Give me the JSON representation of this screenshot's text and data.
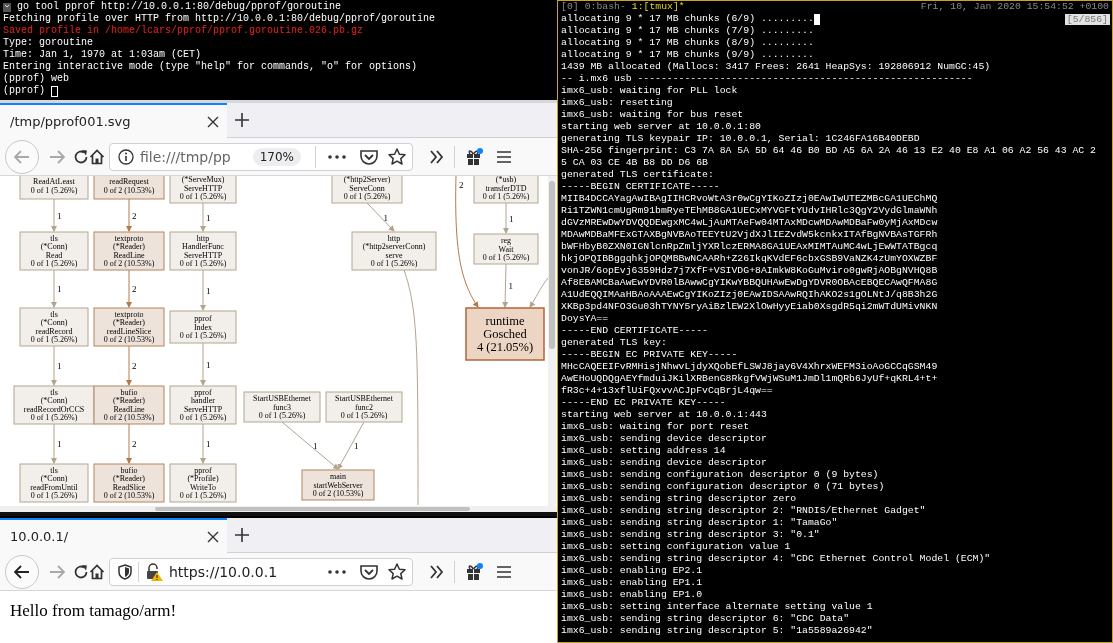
{
  "terminal": {
    "lines": [
      {
        "text": "go tool pprof http://10.0.0.1:80/debug/pprof/goroutine",
        "kind": "command",
        "cursor": false
      },
      {
        "text": "Fetching profile over HTTP from http://10.0.0.1:80/debug/pprof/goroutine",
        "kind": "output",
        "cursor": false
      },
      {
        "text": "Saved profile in /home/lcars/pprof/pprof.goroutine.026.pb.gz",
        "kind": "error",
        "cursor": false
      },
      {
        "text": "Type: goroutine",
        "kind": "output",
        "cursor": false
      },
      {
        "text": "Time: Jan 1, 1970 at 1:03am (CET)",
        "kind": "output",
        "cursor": false
      },
      {
        "text": "Entering interactive mode (type \"help\" for commands, \"o\" for options)",
        "kind": "output",
        "cursor": false
      },
      {
        "text": "(pprof) web",
        "kind": "output",
        "cursor": false
      },
      {
        "text": "(pprof)",
        "kind": "output",
        "cursor": true
      }
    ]
  },
  "browsers": [
    {
      "tabs": [
        {
          "title": "/tmp/pprof001.svg",
          "selected": true
        }
      ],
      "back_disabled": true,
      "forward_disabled": true,
      "gift_badge": true,
      "address": {
        "kind": "file",
        "url": "file:///tmp/pp",
        "zoom": "170%"
      },
      "content": {
        "kind": "graph",
        "graph": {
          "nodes": [
            {
              "lines": [
                "ReadAtLeast",
                "0 of 1 (5.26%)"
              ],
              "kind": "cold"
            },
            {
              "lines": [
                "tls",
                "(*Conn)",
                "Read",
                "0 of 1 (5.26%)"
              ],
              "kind": "cold"
            },
            {
              "lines": [
                "tls",
                "(*Conn)",
                "readRecord",
                "0 of 1 (5.26%)"
              ],
              "kind": "cold"
            },
            {
              "lines": [
                "tls",
                "(*Conn)",
                "readRecordOrCCS",
                "0 of 1 (5.26%)"
              ],
              "kind": "cold"
            },
            {
              "lines": [
                "tls",
                "(*Conn)",
                "readFromUntil",
                "0 of 1 (5.26%)"
              ],
              "kind": "cold"
            },
            {
              "lines": [
                "readRequest",
                "0 of 2 (10.53%)"
              ],
              "kind": "warm"
            },
            {
              "lines": [
                "textproto",
                "(*Reader)",
                "ReadLine",
                "0 of 2 (10.53%)"
              ],
              "kind": "warm"
            },
            {
              "lines": [
                "textproto",
                "(*Reader)",
                "readLineSlice",
                "0 of 2 (10.53%)"
              ],
              "kind": "warm"
            },
            {
              "lines": [
                "bufio",
                "(*Reader)",
                "ReadLine",
                "0 of 2 (10.53%)"
              ],
              "kind": "warm"
            },
            {
              "lines": [
                "bufio",
                "(*Reader)",
                "ReadSlice",
                "0 of 2 (10.53%)"
              ],
              "kind": "warm"
            },
            {
              "lines": [
                "(*ServeMux)",
                "ServeHTTP",
                "0 of 1 (5.26%)"
              ],
              "kind": "cold"
            },
            {
              "lines": [
                "http",
                "HandlerFunc",
                "ServeHTTP",
                "0 of 1 (5.26%)"
              ],
              "kind": "cold"
            },
            {
              "lines": [
                "pprof",
                "Index",
                "0 of 1 (5.26%)"
              ],
              "kind": "cold"
            },
            {
              "lines": [
                "pprof",
                "handler",
                "ServeHTTP",
                "0 of 1 (5.26%)"
              ],
              "kind": "cold"
            },
            {
              "lines": [
                "pprof",
                "(*Profile)",
                "WriteTo",
                "0 of 1 (5.26%)"
              ],
              "kind": "cold"
            },
            {
              "lines": [
                "(*http2Server)",
                "ServeConn",
                "0 of 1 (5.26%)"
              ],
              "kind": "cold"
            },
            {
              "lines": [
                "http",
                "(*http2serverConn)",
                "serve",
                "0 of 1 (5.26%)"
              ],
              "kind": "cold"
            },
            {
              "lines": [
                "StartUSBEthernet",
                "func3",
                "0 of 1 (5.26%)"
              ],
              "kind": "cold"
            },
            {
              "lines": [
                "StartUSBEthernet",
                "func2",
                "0 of 1 (5.26%)"
              ],
              "kind": "cold"
            },
            {
              "lines": [
                "main",
                "startWebServer",
                "0 of 2 (10.53%)"
              ],
              "kind": "warm"
            },
            {
              "lines": [
                "(*usb)",
                "transferDTD",
                "0 of 1 (5.26%)"
              ],
              "kind": "cold"
            },
            {
              "lines": [
                "reg",
                "Wait",
                "0 of 1 (5.26%)"
              ],
              "kind": "cold"
            },
            {
              "lines": [
                "runtime",
                "Gosched",
                "4 (21.05%)"
              ],
              "kind": "hot"
            }
          ],
          "edges": [
            {
              "label": "1",
              "kind": "cold"
            },
            {
              "label": "1",
              "kind": "cold"
            },
            {
              "label": "1",
              "kind": "cold"
            },
            {
              "label": "1",
              "kind": "cold"
            },
            {
              "label": "2",
              "kind": "warm"
            },
            {
              "label": "2",
              "kind": "warm"
            },
            {
              "label": "2",
              "kind": "warm"
            },
            {
              "label": "2",
              "kind": "warm"
            },
            {
              "label": "1",
              "kind": "cold"
            },
            {
              "label": "1",
              "kind": "cold"
            },
            {
              "label": "1",
              "kind": "cold"
            },
            {
              "label": "1",
              "kind": "cold"
            },
            {
              "label": "1",
              "kind": "cold"
            },
            {
              "label": "1",
              "kind": "cold"
            },
            {
              "label": "1",
              "kind": "cold"
            },
            {
              "label": "1",
              "kind": "cold"
            },
            {
              "label": "1",
              "kind": "cold"
            },
            {
              "label": "2",
              "kind": "warm"
            },
            {
              "kind": "cold"
            },
            {
              "kind": "cold"
            }
          ]
        }
      }
    },
    {
      "tabs": [
        {
          "title": "10.0.0.1/",
          "selected": true
        }
      ],
      "back_disabled": false,
      "forward_disabled": true,
      "gift_badge": true,
      "address": {
        "kind": "https",
        "url": "https://10.0.0.1"
      },
      "content": {
        "kind": "text",
        "text": "Hello from tamago/arm!"
      }
    }
  ],
  "tmux": {
    "status": {
      "session": "[0]",
      "windows": [
        {
          "label": "0:bash-",
          "selected": false
        },
        {
          "label": "1:[tmux]*",
          "selected": true
        }
      ],
      "clock": "Fri, 10, Jan 2020 15:54:52 +0100",
      "position": "[5/856]"
    },
    "lines": [
      {
        "text": "allocating 9 * 17 MB chunks (6/9) .........",
        "cursor": true
      },
      {
        "text": "allocating 9 * 17 MB chunks (7/9) .........",
        "cursor": false
      },
      {
        "text": "allocating 9 * 17 MB chunks (8/9) .........",
        "cursor": false
      },
      {
        "text": "allocating 9 * 17 MB chunks (9/9) .........",
        "cursor": false
      },
      {
        "text": "1439 MB allocated (Mallocs: 3417 Frees: 2641 HeapSys: 192806912 NumGC:45)",
        "cursor": false
      },
      {
        "text": "-- i.mx6 usb ---------------------------------------------------------",
        "cursor": false
      },
      {
        "text": "imx6_usb: waiting for PLL lock",
        "cursor": false
      },
      {
        "text": "imx6_usb: resetting",
        "cursor": false
      },
      {
        "text": "imx6_usb: waiting for bus reset",
        "cursor": false
      },
      {
        "text": "starting web server at 10.0.0.1:80",
        "cursor": false
      },
      {
        "text": "generating TLS keypair IP: 10.0.0.1, Serial: 1C246FA16B40DEBD",
        "cursor": false
      },
      {
        "text": "SHA-256 fingerprint: C3 7A 8A 5A 5D 64 46 B0 BD A5 6A 2A 46 13 E2 40 E8 A1 06 A2 56 43 AC 2",
        "cursor": false
      },
      {
        "text": "5 CA 03 CE 4B B8 DD D6 6B",
        "cursor": false
      },
      {
        "text": "generated TLS certificate:",
        "cursor": false
      },
      {
        "text": "-----BEGIN CERTIFICATE-----",
        "cursor": false
      },
      {
        "text": "MIIB4DCCAYagAwIBAgIIHCRvoWtA3r0wCgYIKoZIzj0EAwIwUTEZMBcGA1UEChMQ",
        "cursor": false
      },
      {
        "text": "Ri1TZWN1cmUgRm91bmRyeTEhMB8GA1UECxMYVGFtYUdvIHRlc3QgY2VydGlmaWNh",
        "cursor": false
      },
      {
        "text": "dGVzMREwDwYDVQQDEwgxMC4wLjAuMTAeFw04MTAxMDcwMDAwMDBaFw0yMjAxMDcw",
        "cursor": false
      },
      {
        "text": "MDAwMDBaMFExGTAXBgNVBAoTEEYtU2VjdXJlIEZvdW5kcnkxITAfBgNVBAsTGFRh",
        "cursor": false
      },
      {
        "text": "bWFHbyB0ZXN0IGNlcnRpZmljYXRlczERMA8GA1UEAxMIMTAuMC4wLjEwWTATBgcq",
        "cursor": false
      },
      {
        "text": "hkjOPQIBBggqhkjOPQMBBwNCAARh+Z26IkqKVdEF6cbxGSB9VaNZK4zUmYOXWZBF",
        "cursor": false
      },
      {
        "text": "vonJR/6opEvj6359Hdz7j7XfF+VSIVDG+8AImkW8KoGuMviro0gwRjAOBgNVHQ8B",
        "cursor": false
      },
      {
        "text": "Af8EBAMCBaAwEwYDVR0lBAwwCgYIKwYBBQUHAwEwDgYDVR0OBAcEBQECAwQFMA8G",
        "cursor": false
      },
      {
        "text": "A1UdEQQIMAaHBAoAAAEwCgYIKoZIzj0EAwIDSAAwRQIhAKO2s1gOLNtJ/q8B3h2G",
        "cursor": false
      },
      {
        "text": "XKBp3pd4NFO3Gu03hTYNY5ryAiBzlEW2XlOwHyyEiab0XsgdR5qi2mWTdUMivNKN",
        "cursor": false
      },
      {
        "text": "DoysYA==",
        "cursor": false
      },
      {
        "text": "-----END CERTIFICATE-----",
        "cursor": false
      },
      {
        "text": "generated TLS key:",
        "cursor": false
      },
      {
        "text": "-----BEGIN EC PRIVATE KEY-----",
        "cursor": false
      },
      {
        "text": "MHcCAQEEIFvRMHisjNhwvLjdyXQobEfLSWJ8jay6V4XhrxWEFM3ioAoGCCqGSM49",
        "cursor": false
      },
      {
        "text": "AwEHoUQDQgAEYfmduiJKilXRBenG8RkgfVWjWSuM1JmDl1mQRb6JyUf+qKRL4+t+",
        "cursor": false
      },
      {
        "text": "fR3c+4+13xflUiFQxvvACJpFvCqBrjL4qw==",
        "cursor": false
      },
      {
        "text": "-----END EC PRIVATE KEY-----",
        "cursor": false
      },
      {
        "text": "starting web server at 10.0.0.1:443",
        "cursor": false
      },
      {
        "text": "imx6_usb: waiting for port reset",
        "cursor": false
      },
      {
        "text": "imx6_usb: sending device descriptor",
        "cursor": false
      },
      {
        "text": "imx6_usb: setting address 14",
        "cursor": false
      },
      {
        "text": "imx6_usb: sending device descriptor",
        "cursor": false
      },
      {
        "text": "imx6_usb: sending configuration descriptor 0 (9 bytes)",
        "cursor": false
      },
      {
        "text": "imx6_usb: sending configuration descriptor 0 (71 bytes)",
        "cursor": false
      },
      {
        "text": "imx6_usb: sending string descriptor zero",
        "cursor": false
      },
      {
        "text": "imx6_usb: sending string descriptor 2: \"RNDIS/Ethernet Gadget\"",
        "cursor": false
      },
      {
        "text": "imx6_usb: sending string descriptor 1: \"TamaGo\"",
        "cursor": false
      },
      {
        "text": "imx6_usb: sending string descriptor 3: \"0.1\"",
        "cursor": false
      },
      {
        "text": "imx6_usb: setting configuration value 1",
        "cursor": false
      },
      {
        "text": "imx6_usb: sending string descriptor 4: \"CDC Ethernet Control Model (ECM)\"",
        "cursor": false
      },
      {
        "text": "imx6_usb: enabling EP2.1",
        "cursor": false
      },
      {
        "text": "imx6_usb: enabling EP1.1",
        "cursor": false
      },
      {
        "text": "imx6_usb: enabling EP1.0",
        "cursor": false
      },
      {
        "text": "imx6_usb: setting interface alternate setting value 1",
        "cursor": false
      },
      {
        "text": "imx6_usb: sending string descriptor 6: \"CDC Data\"",
        "cursor": false
      },
      {
        "text": "imx6_usb: sending string descriptor 5: \"1a5589a26942\"",
        "cursor": false
      }
    ]
  }
}
